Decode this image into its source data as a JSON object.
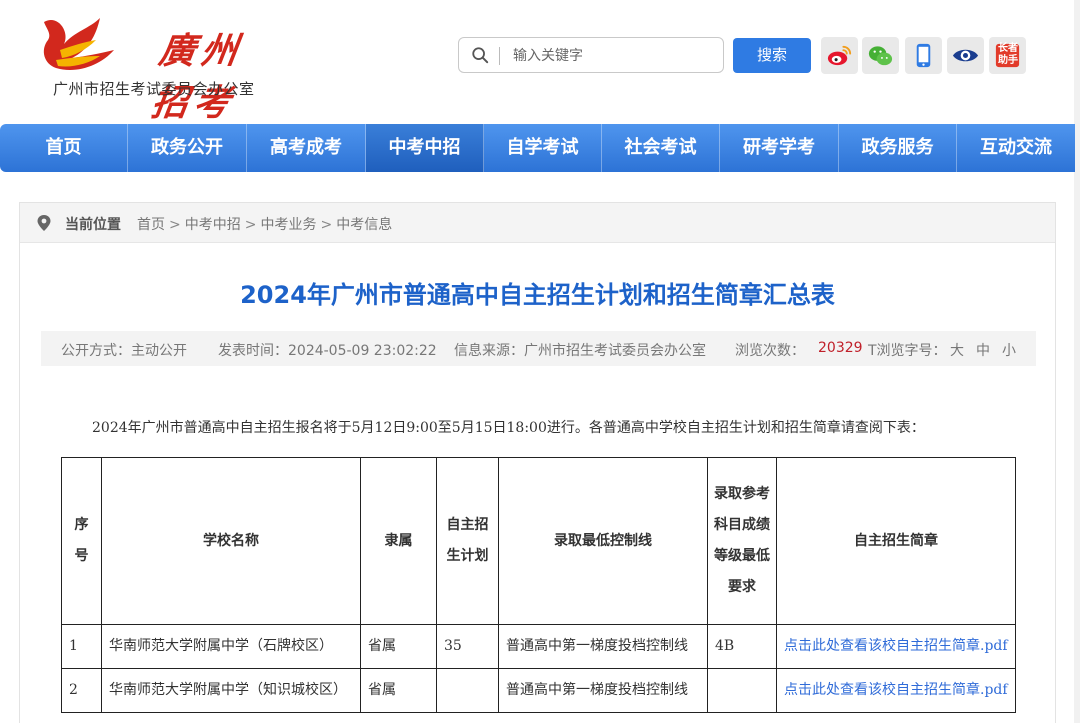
{
  "header": {
    "logo_script": "廣州招考",
    "org_name": "广州市招生考试委员会办公室",
    "search": {
      "placeholder": "输入关键字",
      "button": "搜索"
    },
    "social_icons": [
      "weibo-icon",
      "wechat-icon",
      "mobile-icon",
      "eye-icon",
      "zhangzhe-helper-icon"
    ],
    "zhangzhe_label": "长者助手"
  },
  "nav": {
    "items": [
      {
        "label": "首页",
        "active": false
      },
      {
        "label": "政务公开",
        "active": false
      },
      {
        "label": "高考成考",
        "active": false
      },
      {
        "label": "中考中招",
        "active": true
      },
      {
        "label": "自学考试",
        "active": false
      },
      {
        "label": "社会考试",
        "active": false
      },
      {
        "label": "研考学考",
        "active": false
      },
      {
        "label": "政务服务",
        "active": false
      },
      {
        "label": "互动交流",
        "active": false
      }
    ]
  },
  "breadcrumb": {
    "label": "当前位置",
    "path": [
      "首页",
      "中考中招",
      "中考业务",
      "中考信息"
    ],
    "separator": ">"
  },
  "article": {
    "title": "2024年广州市普通高中自主招生计划和招生简章汇总表",
    "meta": {
      "open_mode": "公开方式：主动公开",
      "publish_time": "发表时间：2024-05-09 23:02:22",
      "source": "信息来源：广州市招生考试委员会办公室",
      "views_label": "浏览次数：",
      "views_count": "20329",
      "font_size_label": "T浏览字号：",
      "font_sizes": [
        "大",
        "中",
        "小"
      ]
    },
    "intro": "2024年广州市普通高中自主招生报名将于5月12日9:00至5月15日18:00进行。各普通高中学校自主招生计划和招生简章请查阅下表：",
    "table": {
      "headers": [
        "序号",
        "学校名称",
        "隶属",
        "自主招生计划",
        "录取最低控制线",
        "录取参考科目成绩等级最低要求",
        "自主招生简章"
      ],
      "rows": [
        {
          "no": "1",
          "school": "华南师范大学附属中学（石牌校区）",
          "affiliation": "省属",
          "plan": "35",
          "min_line": "普通高中第一梯度投档控制线",
          "grade_req": "4B",
          "brochure": "点击此处查看该校自主招生简章.pdf"
        },
        {
          "no": "2",
          "school": "华南师范大学附属中学（知识城校区）",
          "affiliation": "省属",
          "plan": "",
          "min_line": "普通高中第一梯度投档控制线",
          "grade_req": "",
          "brochure": "点击此处查看该校自主招生简章.pdf"
        }
      ]
    }
  },
  "colors": {
    "nav_blue": "#2d73d6",
    "title_blue": "#1d62c9",
    "link_blue": "#2f6bd8",
    "brand_red": "#d2281d",
    "views_red": "#c0202a"
  }
}
